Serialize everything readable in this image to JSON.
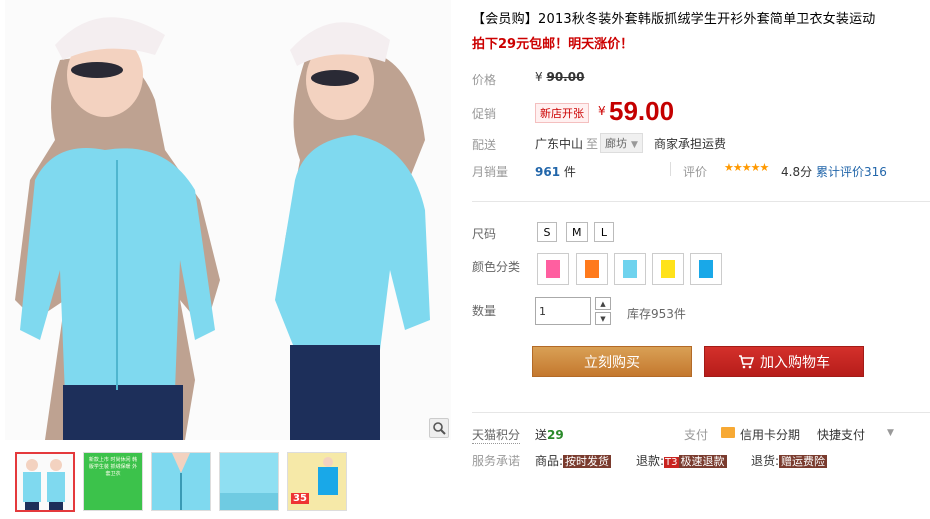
{
  "product": {
    "title": "【会员购】2013秋冬装外套韩版抓绒学生开衫外套简单卫衣女装运动",
    "subtitle": "拍下29元包邮！明天涨价！"
  },
  "price": {
    "orig_label": "价格",
    "orig_currency": "¥",
    "orig_value": "90.00",
    "promo_label": "促销",
    "promo_tag": "新店开张",
    "currency": "¥",
    "value": "59.00"
  },
  "shipping": {
    "label": "配送",
    "from": "广东中山",
    "to_label": "至",
    "to_city": "廊坊",
    "fee": "商家承担运费"
  },
  "sales": {
    "label": "月销量",
    "count": "961",
    "unit": "件",
    "rate_label": "评价",
    "stars": "★★★★★",
    "score": "4.8分",
    "total": "累计评价316"
  },
  "options": {
    "size_label": "尺码",
    "sizes": [
      "S",
      "M",
      "L"
    ],
    "color_label": "颜色分类",
    "colors": [
      "#ff5fa0",
      "#ff7a1c",
      "#6fd3ee",
      "#ffe21a",
      "#19a8e8"
    ]
  },
  "quantity": {
    "label": "数量",
    "value": "1",
    "up": "▲",
    "down": "▼",
    "stock": "库存953件"
  },
  "actions": {
    "buy": "立刻购买",
    "cart": "加入购物车"
  },
  "extras": {
    "tmall_label": "天猫积分",
    "points_prefix": "送",
    "points": "29",
    "pay_label": "支付",
    "credit": "信用卡分期",
    "quick_pay": "快捷支付",
    "quick_arrow": "▼"
  },
  "service": {
    "label": "服务承诺",
    "goods_prefix": "商品:",
    "goods_tag": "按时发货",
    "refund_prefix": "退款:",
    "refund_t3": "T3",
    "refund_tag": "极速退款",
    "return_prefix": "退货:",
    "return_tag": "赠运费险"
  },
  "gallery": {
    "thumb_green_text": "新款上市 时尚休闲 韩版学生装 抓绒保暖 外套卫衣",
    "thumb_promo": "35"
  }
}
